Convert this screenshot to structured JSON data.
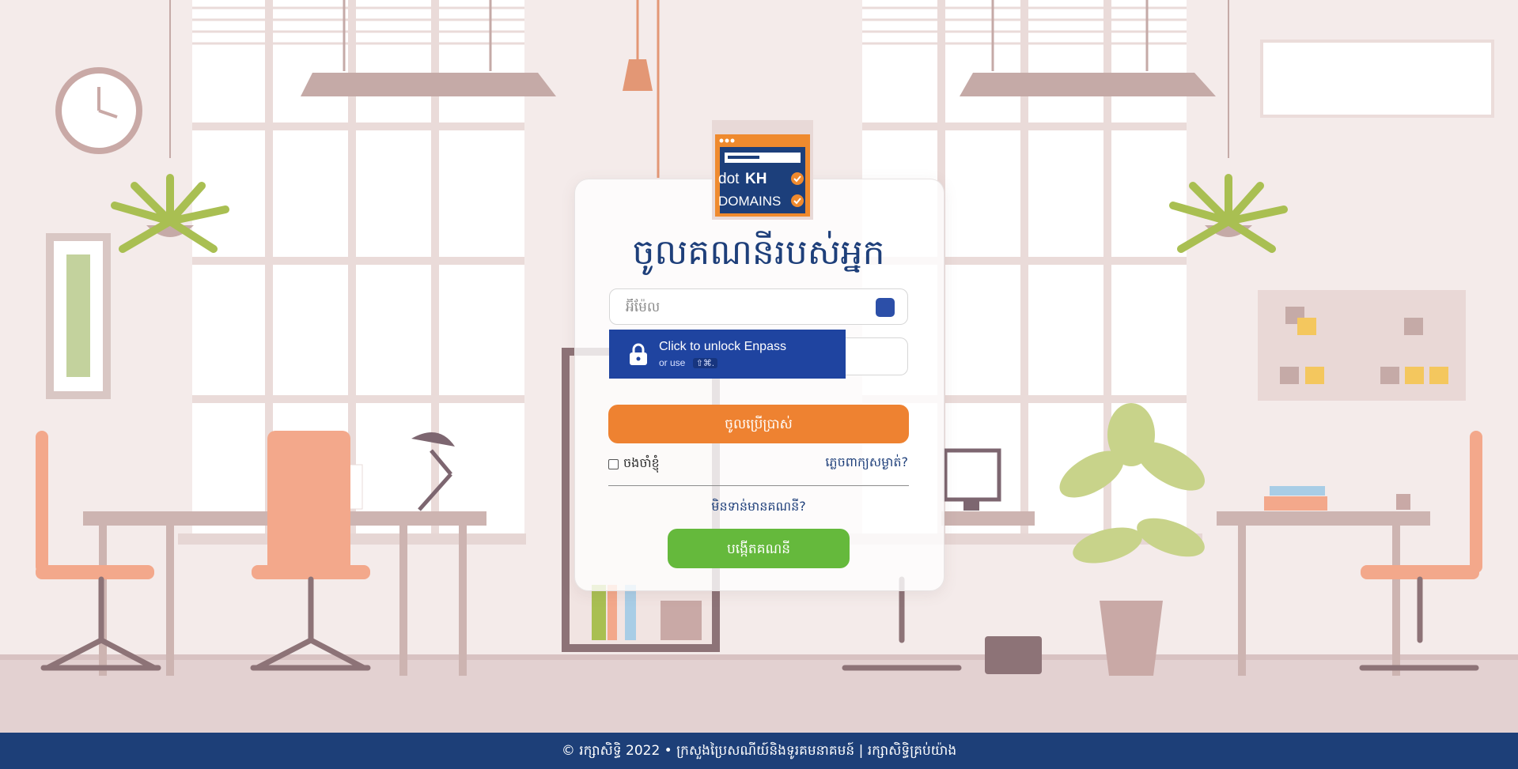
{
  "logo": {
    "line1": "dot",
    "line1_bold": "KH",
    "line2": "DOMAINS"
  },
  "login": {
    "title": "ចូលគណនីរបស់អ្នក",
    "email_placeholder": "អ៊ីម៉ែល",
    "submit_label": "ចូលប្រើប្រាស់",
    "remember_label": "ចងចាំខ្ញុំ",
    "forgot_label": "ភ្លេចពាក្យសម្ងាត់?",
    "no_account_text": "មិនទាន់មានគណនី?",
    "create_label": "បង្កើតគណនី"
  },
  "enpass": {
    "title": "Click to unlock Enpass",
    "subtitle": "or use",
    "shortcut": "⇧⌘."
  },
  "footer": {
    "text": "© រក្សាសិទ្ធិ 2022 • ក្រសួងប្រៃសណីយ៍និងទូរគមនាគមន៍ | រក្សាសិទ្ធិគ្រប់យ៉ាង"
  },
  "colors": {
    "navy": "#1d3f78",
    "orange": "#ee8231",
    "green": "#65b93c",
    "enpass": "#1f44a0"
  }
}
